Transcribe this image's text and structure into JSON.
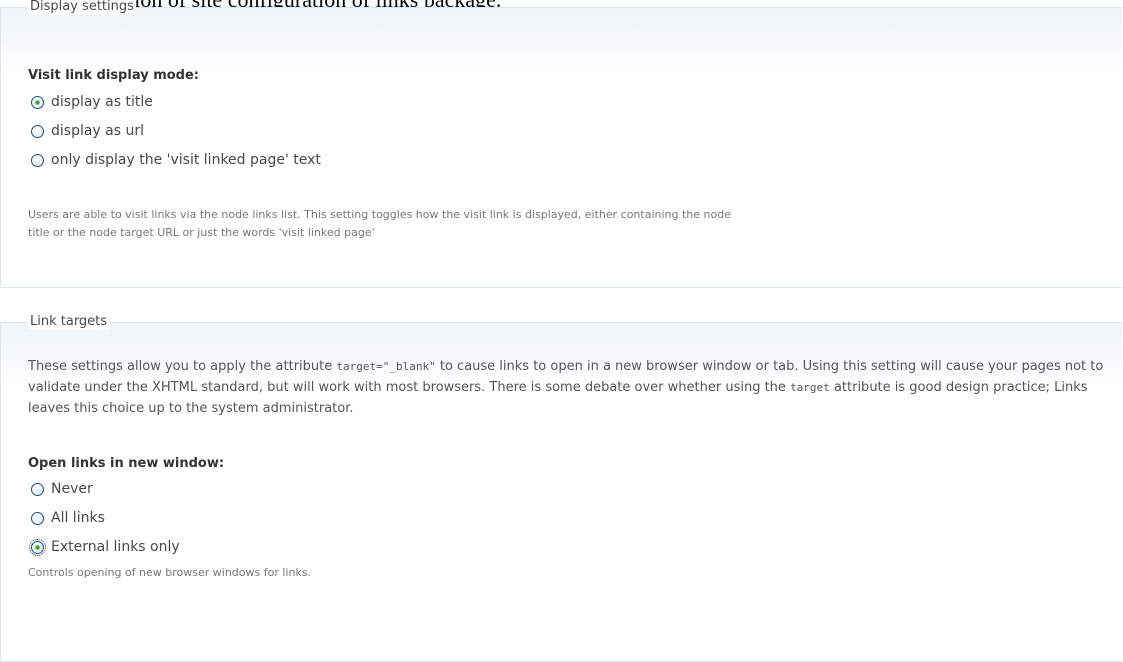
{
  "caption": "section of site configuration of links package.",
  "display_settings": {
    "legend": "Display settings",
    "label": "Visit link display mode:",
    "options": [
      {
        "label": "display as title",
        "checked": true
      },
      {
        "label": "display as url",
        "checked": false
      },
      {
        "label": "only display the 'visit linked page' text",
        "checked": false
      }
    ],
    "description_line1": "Users are able to visit links via the node links list. This setting toggles how the visit link is displayed, either containing the node",
    "description_line2": "title or the node target URL or just the words 'visit linked page'"
  },
  "link_targets": {
    "legend": "Link targets",
    "intro": {
      "part1": "These settings allow you to apply the attribute ",
      "code1": "target=\"_blank\"",
      "part2": " to cause links to open in a new browser window or tab. Using this setting will cause your pages not to validate under the XHTML standard, but will work with most browsers. There is some debate over whether using the ",
      "code2": "target",
      "part3": " attribute is good design practice; Links leaves this choice up to the system administrator."
    },
    "label": "Open links in new window:",
    "options": [
      {
        "label": "Never",
        "checked": false
      },
      {
        "label": "All links",
        "checked": false
      },
      {
        "label": "External links only",
        "checked": true
      }
    ],
    "description": "Controls opening of new browser windows for links."
  }
}
